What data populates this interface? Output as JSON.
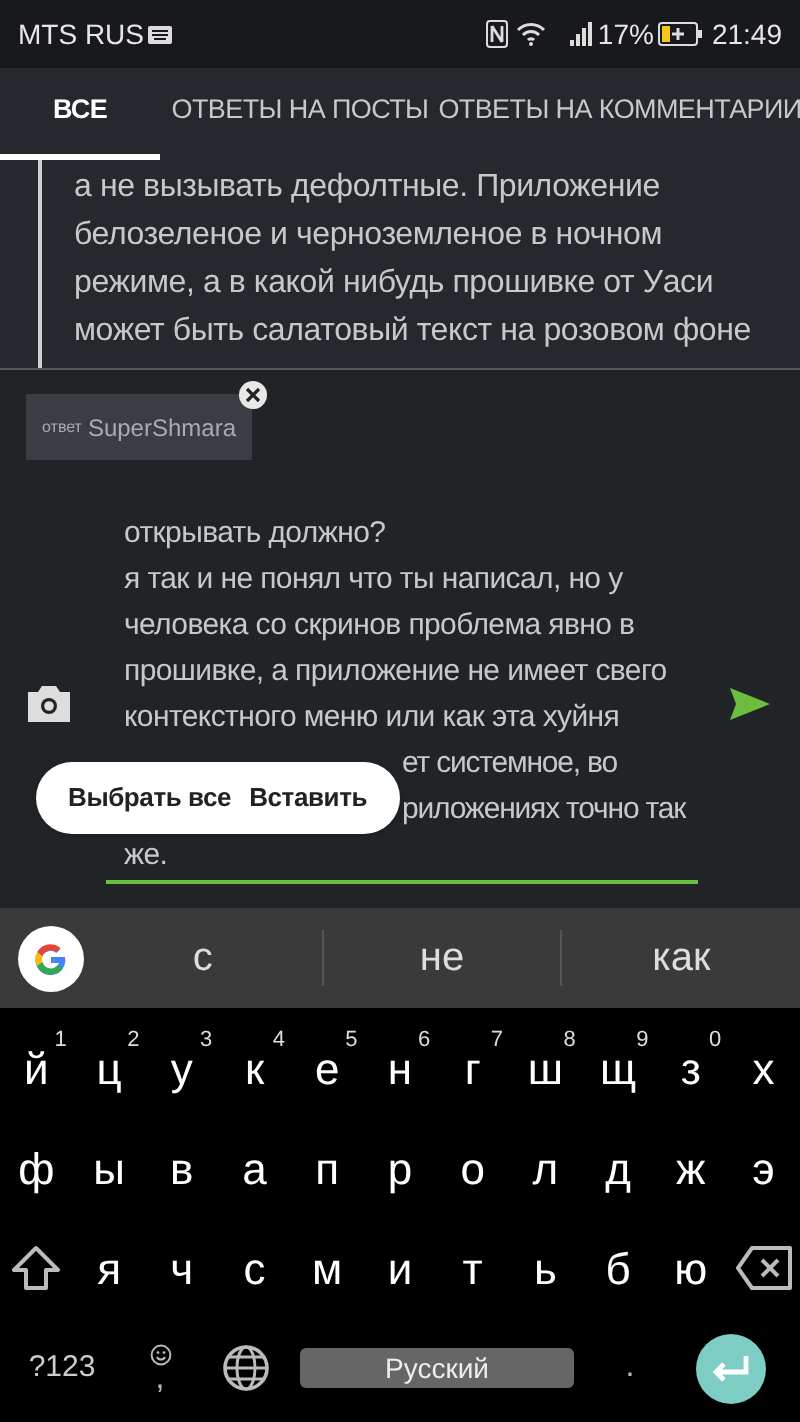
{
  "status_bar": {
    "carrier": "MTS RUS",
    "battery": "17%",
    "time": "21:49"
  },
  "tabs": [
    {
      "label": "ВСЕ",
      "selected": true
    },
    {
      "label": "ОТВЕТЫ НА ПОСТЫ",
      "selected": false
    },
    {
      "label": "ОТВЕТЫ НА КОММЕНТАРИИ",
      "selected": false
    }
  ],
  "post": {
    "lines": [
      "а не вызывать дефолтные. Приложение",
      "белозеленое и черноземленое в ночном",
      "режиме, а в какой нибудь прошивке от Уаси",
      "может быть салатовый текст на розовом фоне"
    ]
  },
  "reply_chip": {
    "prefix": "ответ",
    "user": "SuperShmara"
  },
  "message_field": {
    "lines": [
      {
        "text": "открывать должно?",
        "kind": "full"
      },
      {
        "text": "я так и не понял что ты написал, но у",
        "kind": "full"
      },
      {
        "text": "человека со скринов проблема явно в",
        "kind": "full"
      },
      {
        "text": "прошивке, а приложение не имеет свего",
        "kind": "full"
      },
      {
        "text": "контекстного меню или как эта хуйня",
        "kind": "full"
      },
      {
        "text": "ет системное, во",
        "kind": "covered"
      },
      {
        "text": "риложениях точно так",
        "kind": "covered"
      },
      {
        "text": "же.",
        "kind": "full"
      }
    ]
  },
  "context_menu": [
    "Выбрать все",
    "Вставить"
  ],
  "keyboard": {
    "suggestions": [
      "с",
      "не",
      "как"
    ],
    "rows": [
      [
        {
          "key": "й",
          "hint": "1"
        },
        {
          "key": "ц",
          "hint": "2"
        },
        {
          "key": "у",
          "hint": "3"
        },
        {
          "key": "к",
          "hint": "4"
        },
        {
          "key": "е",
          "hint": "5"
        },
        {
          "key": "н",
          "hint": "6"
        },
        {
          "key": "г",
          "hint": "7"
        },
        {
          "key": "ш",
          "hint": "8"
        },
        {
          "key": "щ",
          "hint": "9"
        },
        {
          "key": "з",
          "hint": "0"
        },
        {
          "key": "х"
        }
      ],
      [
        {
          "key": "ф"
        },
        {
          "key": "ы"
        },
        {
          "key": "в"
        },
        {
          "key": "а"
        },
        {
          "key": "п"
        },
        {
          "key": "р"
        },
        {
          "key": "о"
        },
        {
          "key": "л"
        },
        {
          "key": "д"
        },
        {
          "key": "ж"
        },
        {
          "key": "э"
        }
      ],
      [
        {
          "kind": "shift"
        },
        {
          "key": "я"
        },
        {
          "key": "ч"
        },
        {
          "key": "с"
        },
        {
          "key": "м"
        },
        {
          "key": "и"
        },
        {
          "key": "т"
        },
        {
          "key": "ь"
        },
        {
          "key": "б"
        },
        {
          "key": "ю"
        },
        {
          "kind": "backspace"
        }
      ]
    ],
    "symbols": "?123",
    "comma": ",",
    "space": "Русский",
    "period": "."
  }
}
